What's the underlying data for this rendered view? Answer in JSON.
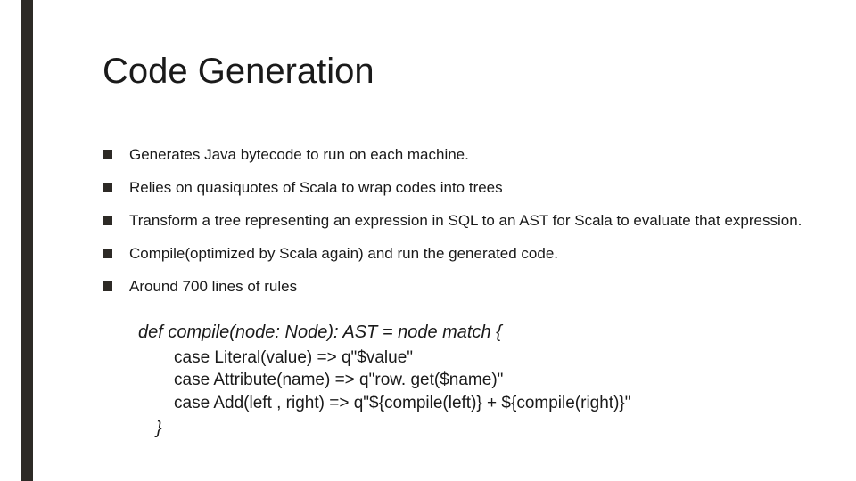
{
  "title": "Code Generation",
  "bullets": [
    "Generates Java bytecode to run on each machine.",
    "Relies on quasiquotes of Scala to wrap codes into trees",
    "Transform a tree representing an expression in SQL to an AST for Scala to evaluate that expression.",
    "Compile(optimized by Scala again) and run the generated code.",
    "Around 700 lines of rules"
  ],
  "code": {
    "signature": "def compile(node: Node): AST = node match {",
    "cases": [
      "case Literal(value) => q\"$value\"",
      "case Attribute(name) => q\"row. get($name)\"",
      "case Add(left , right) => q\"${compile(left)} + ${compile(right)}\""
    ],
    "close": "}"
  }
}
